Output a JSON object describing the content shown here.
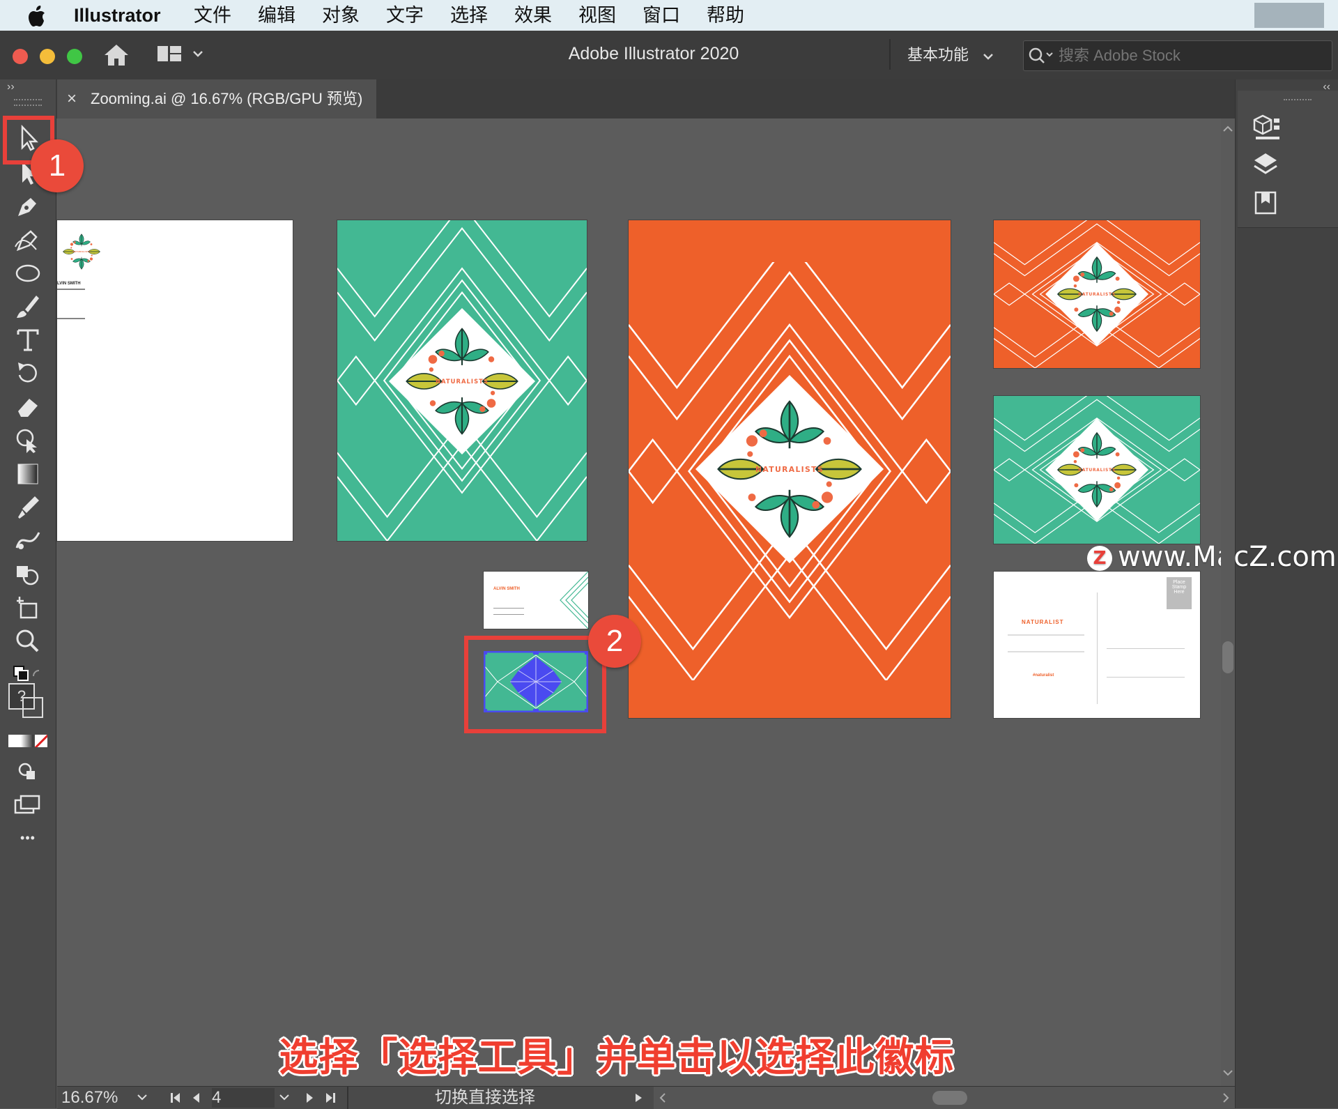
{
  "menubar": {
    "app_name": "Illustrator",
    "items": [
      "文件",
      "编辑",
      "对象",
      "文字",
      "选择",
      "效果",
      "视图",
      "窗口",
      "帮助"
    ]
  },
  "titlebar": {
    "title": "Adobe Illustrator 2020",
    "workspace": "基本功能",
    "search_placeholder": "搜索 Adobe Stock"
  },
  "tab": {
    "close": "×",
    "label": "Zooming.ai @ 16.67% (RGB/GPU 预览)"
  },
  "toolbar": {
    "help_glyph": "?",
    "more_glyph": "•••"
  },
  "annotations": {
    "badge1": "1",
    "badge2": "2",
    "caption": "选择「选择工具」并单击以选择此徽标",
    "watermark": "www.MacZ.com"
  },
  "artwork": {
    "logo_text": "NATURALISTS",
    "postcard_title": "NATURALIST",
    "postcard_tag": "#naturalist",
    "stamp_text": "Place Stamp Here",
    "card_name": "ALVIN SMITH",
    "letter_name": "LVIN SMITH"
  },
  "statusbar": {
    "zoom": "16.67%",
    "artboard": "4",
    "tool_hint": "切换直接选择"
  },
  "colors": {
    "green": "#43b893",
    "orange": "#ee602a",
    "accent_red": "#e8403a",
    "selection_blue": "#4a4af0"
  }
}
